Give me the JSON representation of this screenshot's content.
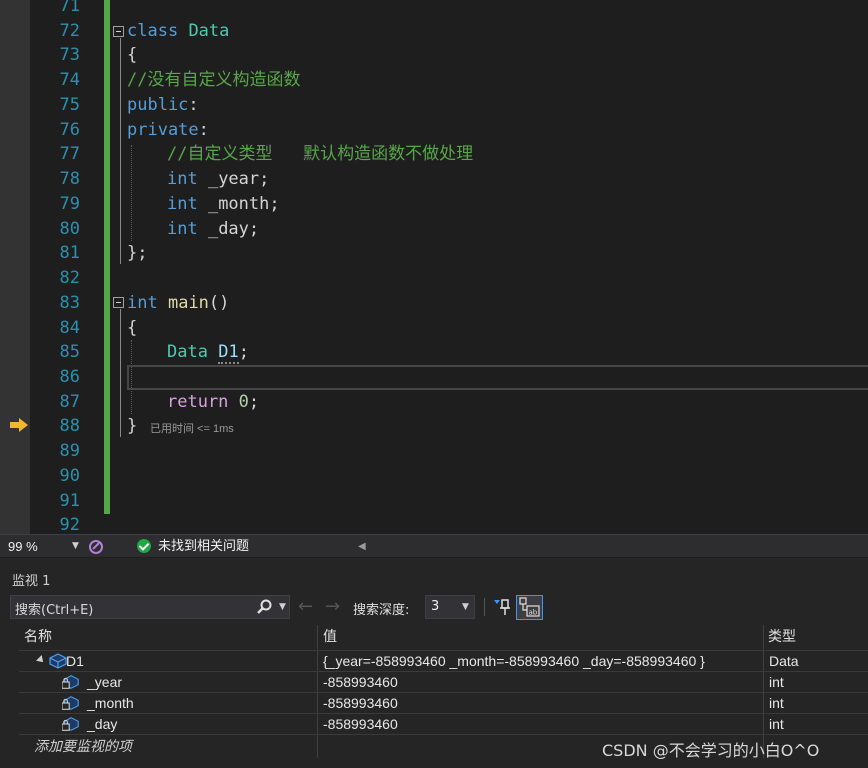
{
  "editor": {
    "line_numbers": [
      "71",
      "72",
      "73",
      "74",
      "75",
      "76",
      "77",
      "78",
      "79",
      "80",
      "81",
      "82",
      "83",
      "84",
      "85",
      "86",
      "87",
      "88",
      "89",
      "90",
      "91",
      "92"
    ],
    "code": {
      "class_kw": "class",
      "class_name": "Data",
      "brace_open": "{",
      "comment1": "//没有自定义构造函数",
      "public_kw": "public",
      "private_kw": "private",
      "colon": ":",
      "comment2": "//自定义类型   默认构造函数不做处理",
      "int_kw": "int",
      "member_year": " _year;",
      "member_month": " _month;",
      "member_day": " _day;",
      "brace_close_semi": "};",
      "main_ret": "int",
      "main_name": "main",
      "parens": "()",
      "local_type": "Data",
      "local_var": "D1",
      "semi": ";",
      "return_kw": "return",
      "zero": "0",
      "brace_close": "}"
    },
    "elapsed": "已用时间 <= 1ms"
  },
  "status": {
    "zoom": "99 %",
    "issues": "未找到相关问题"
  },
  "watch": {
    "title": "监视 1",
    "search_placeholder": "搜索(Ctrl+E)",
    "depth_label": "搜索深度:",
    "depth_value": "3",
    "columns": [
      "名称",
      "值",
      "类型"
    ],
    "rows": [
      {
        "name": "D1",
        "value": "{_year=-858993460 _month=-858993460 _day=-858993460 }",
        "type": "Data"
      },
      {
        "name": "_year",
        "value": "-858993460",
        "type": "int"
      },
      {
        "name": "_month",
        "value": "-858993460",
        "type": "int"
      },
      {
        "name": "_day",
        "value": "-858993460",
        "type": "int"
      }
    ],
    "add_item": "添加要监视的项"
  },
  "watermark": "CSDN @不会学习的小白O^O",
  "colors": {
    "keyword": "#569cd6",
    "type": "#4ec9b0",
    "comment": "#57a64a",
    "line_number": "#2b91af",
    "change_bar": "#57a64a"
  },
  "icons": [
    "fold-toggle-icon",
    "exec-arrow-icon",
    "brush-icon",
    "check-icon",
    "search-icon",
    "pin-icon",
    "hex-display-icon",
    "object-icon",
    "lock-member-icon"
  ]
}
